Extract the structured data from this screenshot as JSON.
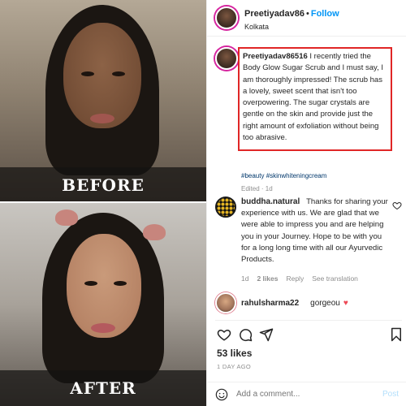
{
  "media": {
    "before_label": "BEFORE",
    "after_label": "AFTER"
  },
  "header": {
    "username": "Preetiyadav86",
    "dot": "•",
    "follow_label": "Follow",
    "location": "Kolkata"
  },
  "caption": {
    "username": "Preetiyadav86516",
    "text": "I recently tried the Body Glow Sugar Scrub and I must say, I am thoroughly impressed! The scrub has a lovely, sweet scent that isn't too overpowering. The sugar crystals are gentle on the skin and provide just the right amount of exfoliation without being too abrasive.",
    "hashtags": "#beauty #skinwhiteningcream",
    "edited": "Edited · 1d"
  },
  "comments": [
    {
      "username": "buddha.natural",
      "text": "Thanks for sharing your experience with us. We are glad that we were able to impress you and are helping you in your Journey. Hope to be with you for a long long time with all our Ayurvedic Products.",
      "age": "1d",
      "likes": "2 likes",
      "reply": "Reply",
      "translation": "See translation"
    },
    {
      "username": "rahulsharma22",
      "text": "gorgeou",
      "emoji": "♥"
    }
  ],
  "stats": {
    "likes": "53 likes",
    "date": "1 DAY AGO"
  },
  "add_comment": {
    "placeholder": "Add a comment...",
    "post_label": "Post"
  },
  "colors": {
    "accent_blue": "#0095f6",
    "highlight_red": "#e02626",
    "heart_red": "#ed4956"
  }
}
